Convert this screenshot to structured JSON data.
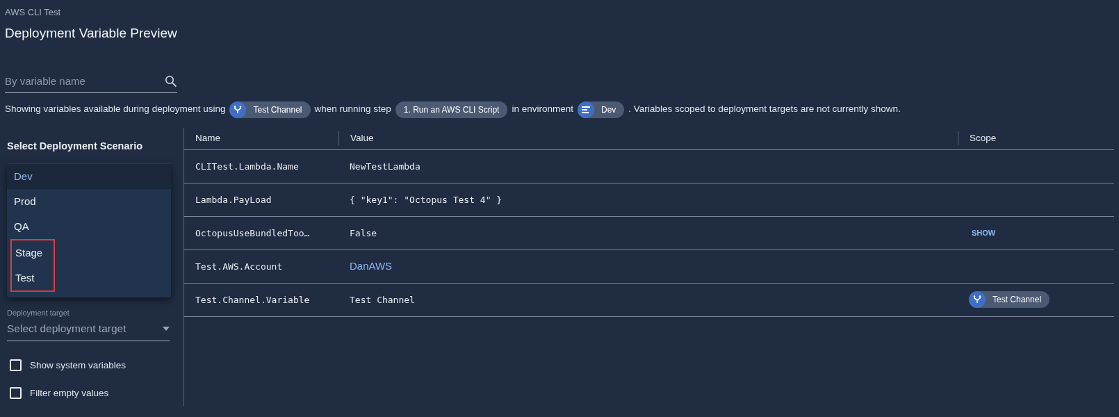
{
  "header": {
    "project": "AWS CLI Test",
    "title": "Deployment Variable Preview"
  },
  "search": {
    "placeholder": "By variable name"
  },
  "summary": [
    {
      "kind": "text",
      "text": "Showing variables available during deployment using"
    },
    {
      "kind": "channel",
      "text": "Test Channel"
    },
    {
      "kind": "text",
      "text": "when running step"
    },
    {
      "kind": "step",
      "text": "1. Run an AWS CLI Script"
    },
    {
      "kind": "text",
      "text": "in environment"
    },
    {
      "kind": "environment",
      "text": "Dev"
    },
    {
      "kind": "text",
      "text": ". Variables scoped to deployment targets are not currently shown."
    }
  ],
  "sidebar": {
    "title": "Select Deployment Scenario",
    "menu": [
      {
        "label": "Dev",
        "selected": true,
        "highlighted": false
      },
      {
        "label": "Prod",
        "selected": false,
        "highlighted": false
      },
      {
        "label": "QA",
        "selected": false,
        "highlighted": false
      },
      {
        "label": "Stage",
        "selected": false,
        "highlighted": true
      },
      {
        "label": "Test",
        "selected": false,
        "highlighted": true
      }
    ],
    "target": {
      "label": "Deployment target",
      "placeholder": "Select deployment target"
    },
    "checkboxes": [
      {
        "label": "Show system variables",
        "checked": false
      },
      {
        "label": "Filter empty values",
        "checked": false
      }
    ]
  },
  "table": {
    "columns": [
      "Name",
      "Value",
      "Scope"
    ],
    "rows": [
      {
        "name": "CLITest.Lambda.Name",
        "value": "NewTestLambda",
        "kind": "text"
      },
      {
        "name": "Lambda.PayLoad",
        "value": "{ \"key1\": \"Octopus Test 4\" }",
        "kind": "text"
      },
      {
        "name": "OctopusUseBundledToo…",
        "value": "False",
        "kind": "text",
        "scope": {
          "kind": "show",
          "text": "SHOW"
        }
      },
      {
        "name": "Test.AWS.Account",
        "value": "DanAWS",
        "kind": "link"
      },
      {
        "name": "Test.Channel.Variable",
        "value": "Test Channel",
        "kind": "text",
        "scope": {
          "kind": "channel",
          "text": "Test Channel"
        }
      }
    ]
  }
}
